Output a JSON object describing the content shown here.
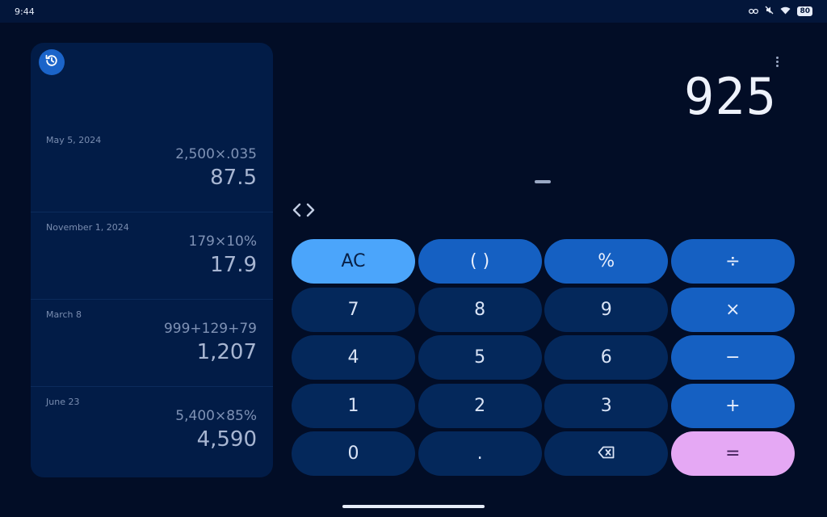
{
  "status_bar": {
    "time": "9:44",
    "battery": "80",
    "icons": [
      "link-icon",
      "mute-icon",
      "wifi-icon",
      "battery-icon"
    ]
  },
  "history": {
    "items": [
      {
        "date": "May 5, 2024",
        "expression": "2,500×.035",
        "result": "87.5"
      },
      {
        "date": "November 1, 2024",
        "expression": "179×10%",
        "result": "17.9"
      },
      {
        "date": "March 8",
        "expression": "999+129+79",
        "result": "1,207"
      },
      {
        "date": "June 23",
        "expression": "5,400×85%",
        "result": "4,590"
      }
    ]
  },
  "display": {
    "result": "925"
  },
  "keys": {
    "ac": "AC",
    "parens": "( )",
    "percent": "%",
    "divide": "÷",
    "seven": "7",
    "eight": "8",
    "nine": "9",
    "multiply": "×",
    "four": "4",
    "five": "5",
    "six": "6",
    "minus": "−",
    "one": "1",
    "two": "2",
    "three": "3",
    "plus": "+",
    "zero": "0",
    "decimal": ".",
    "equals": "="
  },
  "colors": {
    "background": "#020d26",
    "panel": "#021c47",
    "number_key": "#04285b",
    "function_key": "#1560c2",
    "ac_key": "#4ba5fb",
    "equals_key": "#e5a8f4"
  }
}
